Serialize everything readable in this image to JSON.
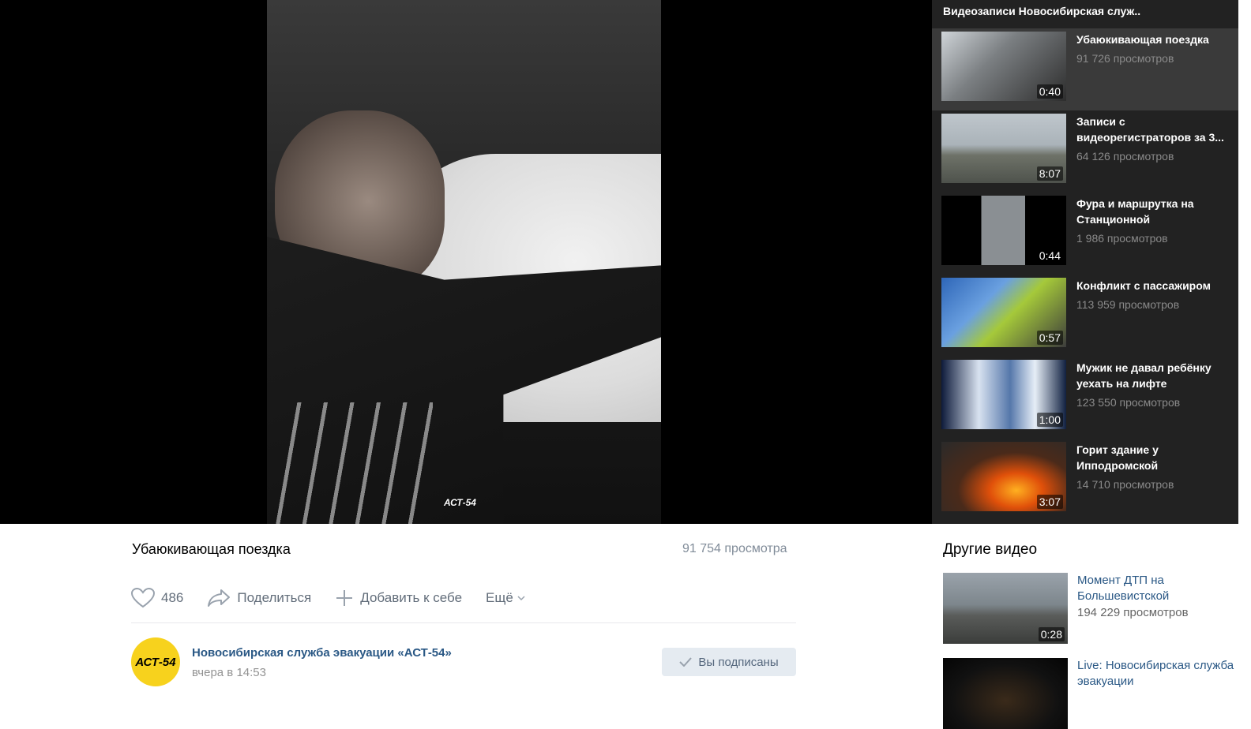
{
  "video": {
    "title": "Убаюкивающая поездка",
    "views": "91 754 просмотра",
    "watermark": "АСТ-54"
  },
  "actions": {
    "likes": "486",
    "share": "Поделиться",
    "add": "Добавить к себе",
    "more": "Ещё"
  },
  "group": {
    "name": "Новосибирская служба эвакуации «АСТ-54»",
    "posted": "вчера в 14:53",
    "subscribed": "Вы подписаны",
    "avatar_text": "АСТ-54"
  },
  "playlist": {
    "title": "Видеозаписи Новосибирская служ..",
    "items": [
      {
        "title": "Убаюкивающая поездка",
        "views": "91 726 просмотров",
        "duration": "0:40"
      },
      {
        "title": "Записи с видеорегистраторов за 3...",
        "views": "64 126 просмотров",
        "duration": "8:07"
      },
      {
        "title": "Фура и маршрутка на Станционной",
        "views": "1 986 просмотров",
        "duration": "0:44"
      },
      {
        "title": "Конфликт с пассажиром",
        "views": "113 959 просмотров",
        "duration": "0:57"
      },
      {
        "title": "Мужик не давал ребёнку уехать на лифте",
        "views": "123 550 просмотров",
        "duration": "1:00"
      },
      {
        "title": "Горит здание у Ипподромской",
        "views": "14 710 просмотров",
        "duration": "3:07"
      }
    ]
  },
  "other": {
    "title": "Другие видео",
    "items": [
      {
        "title": "Момент ДТП на Большевистской",
        "views": "194 229 просмотров",
        "duration": "0:28"
      },
      {
        "title": "Live: Новосибирская служба эвакуации",
        "views": "",
        "duration": ""
      }
    ]
  },
  "colors": {
    "link": "#2a5885",
    "sidebar_bg": "#222222",
    "active_bg": "#3a3a3a",
    "accent_yellow": "#f7d21d"
  }
}
